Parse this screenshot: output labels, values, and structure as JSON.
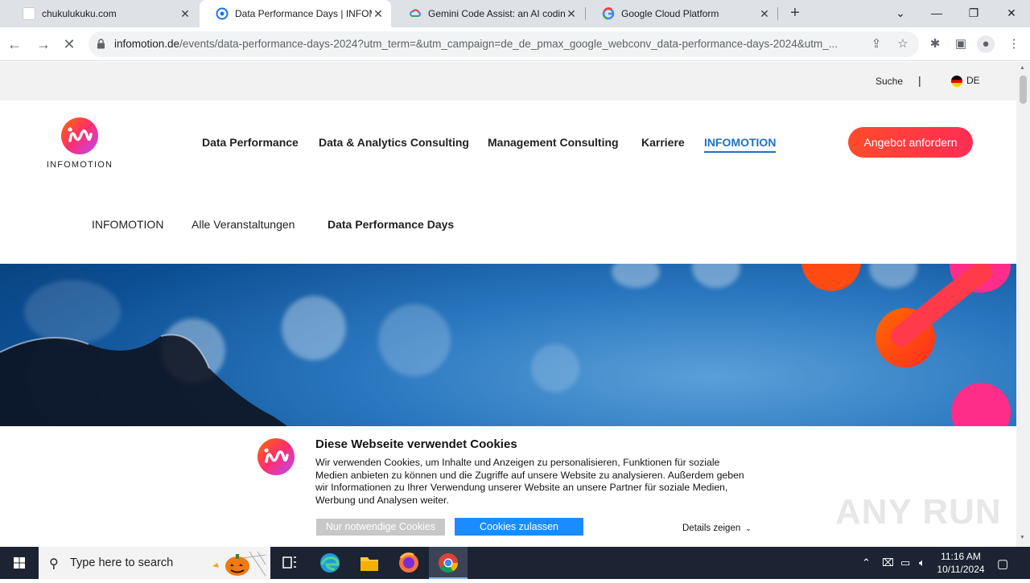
{
  "browser": {
    "tabs": [
      {
        "title": "chukulukuku.com",
        "active": false
      },
      {
        "title": "Data Performance Days | INFOMOTION",
        "active": true
      },
      {
        "title": "Gemini Code Assist: an AI coding assistant",
        "active": false
      },
      {
        "title": "Google Cloud Platform",
        "active": false
      }
    ],
    "url_host": "infomotion.de",
    "url_path": "/events/data-performance-days-2024?utm_term=&utm_campaign=de_de_pmax_google_webconv_data-performance-days-2024&utm_..."
  },
  "site": {
    "topbar": {
      "search_label": "Suche",
      "separator": "|",
      "lang_label": "DE"
    },
    "logo_text": "INFOMOTION",
    "nav": [
      {
        "label": "Data Performance",
        "active": false
      },
      {
        "label": "Data & Analytics Consulting",
        "active": false
      },
      {
        "label": "Management Consulting",
        "active": false
      },
      {
        "label": "Karriere",
        "active": false
      },
      {
        "label": "INFOMOTION",
        "active": true
      }
    ],
    "cta_label": "Angebot anfordern",
    "breadcrumbs": [
      "INFOMOTION",
      "Alle Veranstaltungen",
      "Data Performance Days"
    ]
  },
  "cookie_banner": {
    "title": "Diese Webseite verwendet Cookies",
    "body": "Wir verwenden Cookies, um Inhalte und Anzeigen zu personalisieren, Funktionen für soziale Medien anbieten zu können und die Zugriffe auf unsere Website zu analysieren. Außerdem geben wir Informationen zu Ihrer Verwendung unserer Website an unsere Partner für soziale Medien, Werbung und Analysen weiter.",
    "necessary_label": "Nur notwendige Cookies",
    "allow_label": "Cookies zulassen",
    "details_label": "Details zeigen"
  },
  "watermark": "ANY RUN",
  "taskbar": {
    "search_placeholder": "Type here to search",
    "time": "11:16 AM",
    "date": "10/11/2024"
  },
  "colors": {
    "brand_blue": "#1a73c8",
    "cta_orange": "#ff4b2b",
    "cookie_allow": "#1a8cff"
  }
}
